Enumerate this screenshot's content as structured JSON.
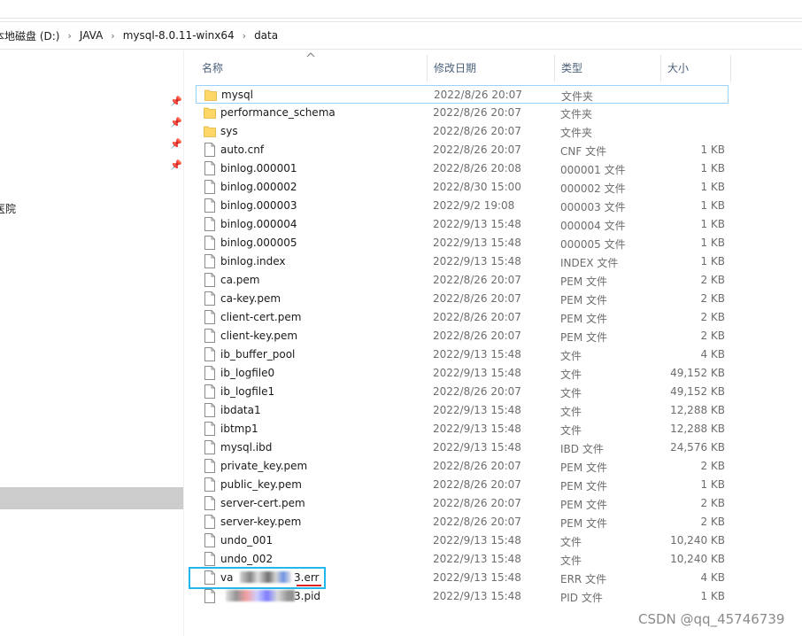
{
  "address_bar": {
    "crumbs": [
      "本地磁盘 (D:)",
      "JAVA",
      "mysql-8.0.11-winx64",
      "data"
    ],
    "separator": "›"
  },
  "nav_pane": {
    "item_text": "医院"
  },
  "columns": {
    "name": "名称",
    "date": "修改日期",
    "type": "类型",
    "size": "大小"
  },
  "files": [
    {
      "name": "mysql",
      "date": "2022/8/26 20:07",
      "type": "文件夹",
      "size": "",
      "kind": "folder"
    },
    {
      "name": "performance_schema",
      "date": "2022/8/26 20:07",
      "type": "文件夹",
      "size": "",
      "kind": "folder"
    },
    {
      "name": "sys",
      "date": "2022/8/26 20:07",
      "type": "文件夹",
      "size": "",
      "kind": "folder"
    },
    {
      "name": "auto.cnf",
      "date": "2022/8/26 20:07",
      "type": "CNF 文件",
      "size": "1 KB",
      "kind": "file"
    },
    {
      "name": "binlog.000001",
      "date": "2022/8/26 20:08",
      "type": "000001 文件",
      "size": "1 KB",
      "kind": "file"
    },
    {
      "name": "binlog.000002",
      "date": "2022/8/30 15:00",
      "type": "000002 文件",
      "size": "1 KB",
      "kind": "file"
    },
    {
      "name": "binlog.000003",
      "date": "2022/9/2 19:08",
      "type": "000003 文件",
      "size": "1 KB",
      "kind": "file"
    },
    {
      "name": "binlog.000004",
      "date": "2022/9/13 15:48",
      "type": "000004 文件",
      "size": "1 KB",
      "kind": "file"
    },
    {
      "name": "binlog.000005",
      "date": "2022/9/13 15:48",
      "type": "000005 文件",
      "size": "1 KB",
      "kind": "file"
    },
    {
      "name": "binlog.index",
      "date": "2022/9/13 15:48",
      "type": "INDEX 文件",
      "size": "1 KB",
      "kind": "file"
    },
    {
      "name": "ca.pem",
      "date": "2022/8/26 20:07",
      "type": "PEM 文件",
      "size": "2 KB",
      "kind": "file"
    },
    {
      "name": "ca-key.pem",
      "date": "2022/8/26 20:07",
      "type": "PEM 文件",
      "size": "2 KB",
      "kind": "file"
    },
    {
      "name": "client-cert.pem",
      "date": "2022/8/26 20:07",
      "type": "PEM 文件",
      "size": "2 KB",
      "kind": "file"
    },
    {
      "name": "client-key.pem",
      "date": "2022/8/26 20:07",
      "type": "PEM 文件",
      "size": "2 KB",
      "kind": "file"
    },
    {
      "name": "ib_buffer_pool",
      "date": "2022/9/13 15:48",
      "type": "文件",
      "size": "4 KB",
      "kind": "file"
    },
    {
      "name": "ib_logfile0",
      "date": "2022/9/13 15:48",
      "type": "文件",
      "size": "49,152 KB",
      "kind": "file"
    },
    {
      "name": "ib_logfile1",
      "date": "2022/8/26 20:07",
      "type": "文件",
      "size": "49,152 KB",
      "kind": "file"
    },
    {
      "name": "ibdata1",
      "date": "2022/9/13 15:48",
      "type": "文件",
      "size": "12,288 KB",
      "kind": "file"
    },
    {
      "name": "ibtmp1",
      "date": "2022/9/13 15:48",
      "type": "文件",
      "size": "12,288 KB",
      "kind": "file"
    },
    {
      "name": "mysql.ibd",
      "date": "2022/9/13 15:48",
      "type": "IBD 文件",
      "size": "24,576 KB",
      "kind": "file"
    },
    {
      "name": "private_key.pem",
      "date": "2022/8/26 20:07",
      "type": "PEM 文件",
      "size": "2 KB",
      "kind": "file"
    },
    {
      "name": "public_key.pem",
      "date": "2022/8/26 20:07",
      "type": "PEM 文件",
      "size": "1 KB",
      "kind": "file"
    },
    {
      "name": "server-cert.pem",
      "date": "2022/8/26 20:07",
      "type": "PEM 文件",
      "size": "2 KB",
      "kind": "file"
    },
    {
      "name": "server-key.pem",
      "date": "2022/8/26 20:07",
      "type": "PEM 文件",
      "size": "2 KB",
      "kind": "file"
    },
    {
      "name": "undo_001",
      "date": "2022/9/13 15:48",
      "type": "文件",
      "size": "10,240 KB",
      "kind": "file"
    },
    {
      "name": "undo_002",
      "date": "2022/9/13 15:48",
      "type": "文件",
      "size": "10,240 KB",
      "kind": "file"
    },
    {
      "name": "va",
      "name_suffix": "3.err",
      "date": "2022/9/13 15:48",
      "type": "ERR 文件",
      "size": "4 KB",
      "kind": "file"
    },
    {
      "name": "",
      "name_suffix": "3.pid",
      "date": "2022/9/13 15:48",
      "type": "PID 文件",
      "size": "1 KB",
      "kind": "file"
    }
  ],
  "watermark": "CSDN @qq_45746739",
  "colors": {
    "folder": "#ffd766",
    "selection_border": "#99d1ff",
    "highlight_box": "#21b7e8",
    "underline": "#e02020"
  }
}
